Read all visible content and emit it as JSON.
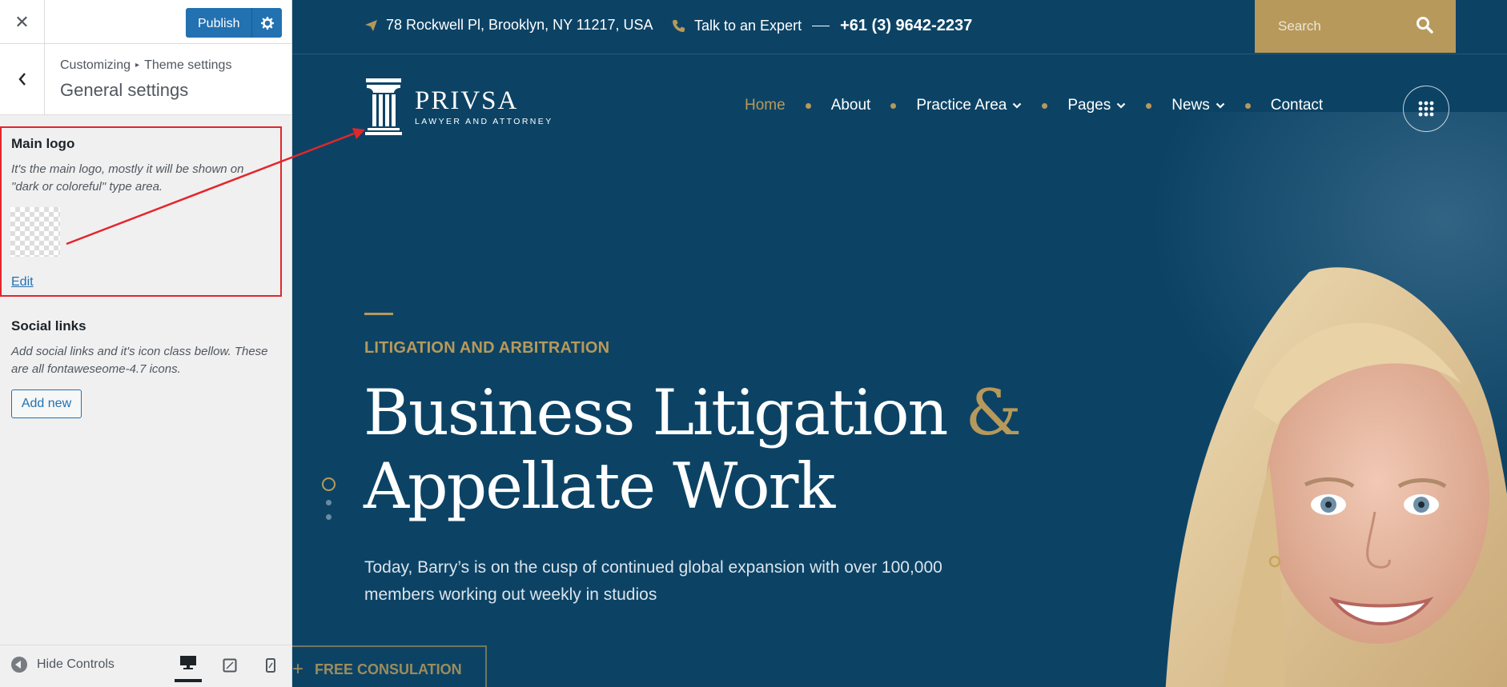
{
  "customizer": {
    "close_icon_glyph": "✕",
    "publish_label": "Publish",
    "breadcrumb_root": "Customizing",
    "breadcrumb_separator": "▸",
    "breadcrumb_current": "Theme settings",
    "section_title": "General settings",
    "main_logo": {
      "title": "Main logo",
      "description": "It's the main logo, mostly it will be shown on \"dark or coloreful\" type area.",
      "edit_label": "Edit"
    },
    "social_links": {
      "title": "Social links",
      "description": "Add social links and it's icon class bellow. These are all fontaweseome-4.7 icons.",
      "add_label": "Add new"
    },
    "hide_controls_label": "Hide Controls",
    "devices": [
      {
        "icon": "desktop-icon",
        "active": true
      },
      {
        "icon": "tablet-icon",
        "active": false
      },
      {
        "icon": "mobile-icon",
        "active": false
      }
    ],
    "highlight_color": "#e3262a"
  },
  "site": {
    "colors": {
      "primary": "#0c4365",
      "accent": "#b7995b"
    },
    "topbar": {
      "address": "78 Rockwell Pl, Brooklyn, NY 11217, USA",
      "expert_label": "Talk to an Expert",
      "phone": "+61 (3) 9642-2237",
      "search_placeholder": "Search"
    },
    "brand": {
      "name": "PRIVSA",
      "tagline": "LAWYER AND ATTORNEY"
    },
    "nav": [
      {
        "label": "Home",
        "active": true,
        "dropdown": false
      },
      {
        "label": "About",
        "active": false,
        "dropdown": false
      },
      {
        "label": "Practice Area",
        "active": false,
        "dropdown": true
      },
      {
        "label": "Pages",
        "active": false,
        "dropdown": true
      },
      {
        "label": "News",
        "active": false,
        "dropdown": true
      },
      {
        "label": "Contact",
        "active": false,
        "dropdown": false
      }
    ],
    "hero": {
      "kicker": "LITIGATION AND ARBITRATION",
      "title_part1": "Business Litigation",
      "title_amp": "&",
      "title_part2": "Appellate Work",
      "text": "Today, Barry’s is on the cusp of continued global expansion with over 100,000 members working out weekly in studios",
      "cta_label": "FREE CONSULATION"
    }
  }
}
